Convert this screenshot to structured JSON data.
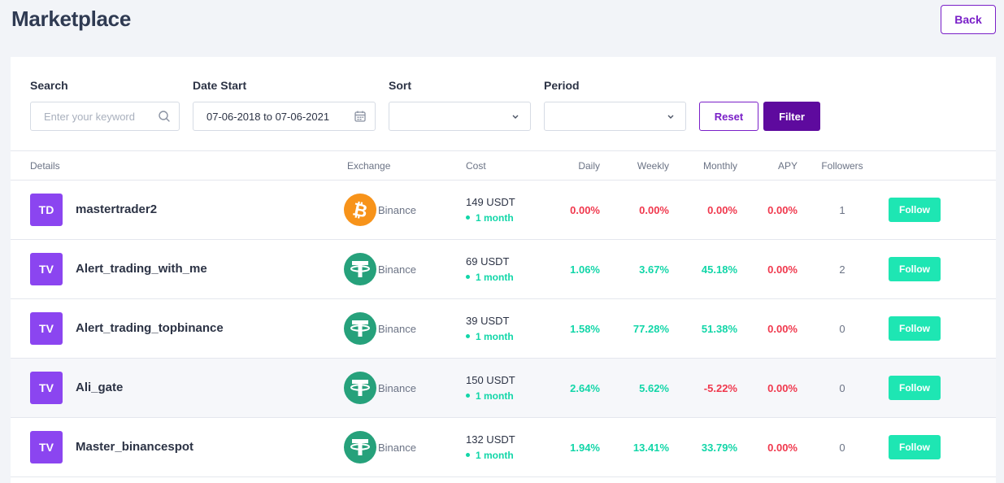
{
  "page": {
    "title": "Marketplace",
    "back_label": "Back"
  },
  "filters": {
    "search_label": "Search",
    "search_placeholder": "Enter your keyword",
    "date_label": "Date Start",
    "date_value": "07-06-2018 to 07-06-2021",
    "sort_label": "Sort",
    "sort_value": "",
    "period_label": "Period",
    "period_value": "",
    "reset_label": "Reset",
    "filter_label": "Filter"
  },
  "table": {
    "headers": {
      "details": "Details",
      "exchange": "Exchange",
      "cost": "Cost",
      "daily": "Daily",
      "weekly": "Weekly",
      "monthly": "Monthly",
      "apy": "APY",
      "followers": "Followers"
    },
    "follow_label": "Follow",
    "rows": [
      {
        "initials": "TD",
        "name": "mastertrader2",
        "coin_icon": "bitcoin-icon",
        "exchange": "Binance",
        "cost": "149 USDT",
        "period": "1 month",
        "daily": "0.00%",
        "weekly": "0.00%",
        "monthly": "0.00%",
        "apy": "0.00%",
        "followers": "1"
      },
      {
        "initials": "TV",
        "name": "Alert_trading_with_me",
        "coin_icon": "tether-icon",
        "exchange": "Binance",
        "cost": "69 USDT",
        "period": "1 month",
        "daily": "1.06%",
        "weekly": "3.67%",
        "monthly": "45.18%",
        "apy": "0.00%",
        "followers": "2"
      },
      {
        "initials": "TV",
        "name": "Alert_trading_topbinance",
        "coin_icon": "tether-icon",
        "exchange": "Binance",
        "cost": "39 USDT",
        "period": "1 month",
        "daily": "1.58%",
        "weekly": "77.28%",
        "monthly": "51.38%",
        "apy": "0.00%",
        "followers": "0"
      },
      {
        "initials": "TV",
        "name": "Ali_gate",
        "coin_icon": "tether-icon",
        "exchange": "Binance",
        "cost": "150 USDT",
        "period": "1 month",
        "daily": "2.64%",
        "weekly": "5.62%",
        "monthly": "-5.22%",
        "apy": "0.00%",
        "followers": "0"
      },
      {
        "initials": "TV",
        "name": "Master_binancespot",
        "coin_icon": "tether-icon",
        "exchange": "Binance",
        "cost": "132 USDT",
        "period": "1 month",
        "daily": "1.94%",
        "weekly": "13.41%",
        "monthly": "33.79%",
        "apy": "0.00%",
        "followers": "0"
      }
    ]
  },
  "colors": {
    "accent": "#7a20c8",
    "filter_button": "#5e0a9e",
    "avatar": "#8b45f0",
    "positive": "#12d6a8",
    "negative": "#f0384d",
    "follow_button": "#1ee6b3",
    "bitcoin": "#f7931a",
    "tether": "#26a17b"
  }
}
